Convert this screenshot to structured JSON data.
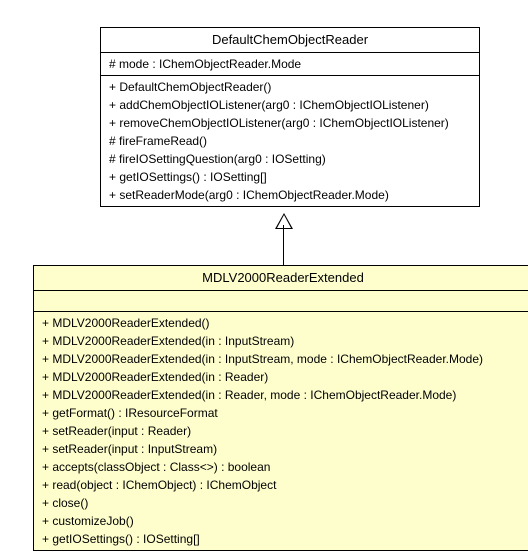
{
  "parent": {
    "name": "DefaultChemObjectReader",
    "attrs": [
      "# mode : IChemObjectReader.Mode"
    ],
    "methods": [
      "+ DefaultChemObjectReader()",
      "+ addChemObjectIOListener(arg0 : IChemObjectIOListener)",
      "+ removeChemObjectIOListener(arg0 : IChemObjectIOListener)",
      "# fireFrameRead()",
      "# fireIOSettingQuestion(arg0 : IOSetting)",
      "+ getIOSettings() : IOSetting[]",
      "+ setReaderMode(arg0 : IChemObjectReader.Mode)"
    ]
  },
  "child": {
    "name": "MDLV2000ReaderExtended",
    "attrs": [],
    "methods": [
      "+ MDLV2000ReaderExtended()",
      "+ MDLV2000ReaderExtended(in : InputStream)",
      "+ MDLV2000ReaderExtended(in : InputStream, mode : IChemObjectReader.Mode)",
      "+ MDLV2000ReaderExtended(in : Reader)",
      "+ MDLV2000ReaderExtended(in : Reader, mode : IChemObjectReader.Mode)",
      "+ getFormat() : IResourceFormat",
      "+ setReader(input : Reader)",
      "+ setReader(input : InputStream)",
      "+ accepts(classObject : Class<>) : boolean",
      "+ read(object : IChemObject) : IChemObject",
      "+ close()",
      "+ customizeJob()",
      "+ getIOSettings() : IOSetting[]"
    ]
  }
}
